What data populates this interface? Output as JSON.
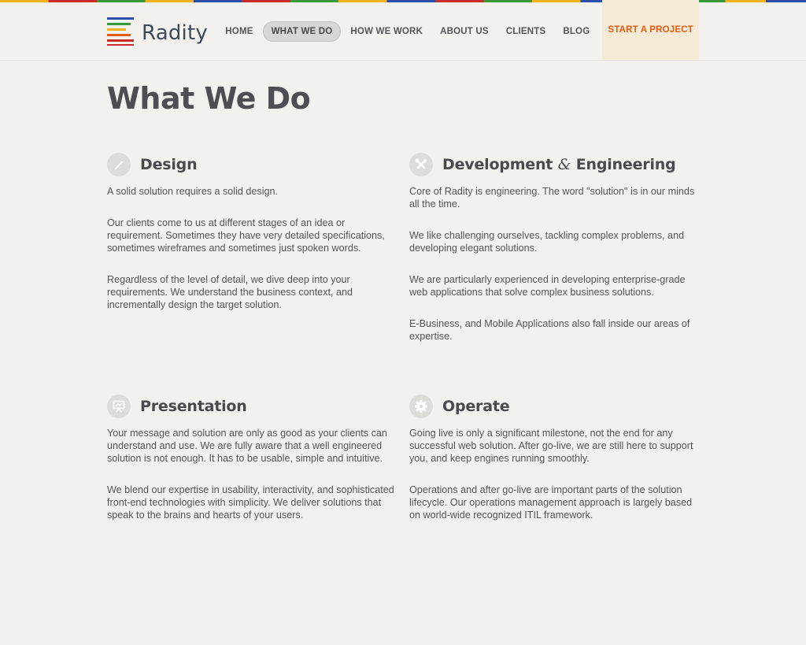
{
  "brand": {
    "name": "Radity"
  },
  "nav": {
    "items": [
      "HOME",
      "WHAT WE DO",
      "HOW WE WORK",
      "ABOUT US",
      "CLIENTS",
      "BLOG"
    ],
    "cta": "START A PROJECT",
    "active_index": 1
  },
  "page": {
    "title": "What We Do"
  },
  "sections": [
    {
      "title": "Design",
      "icon": "pencil-icon",
      "paragraphs": [
        "A solid solution requires a solid design.",
        "Our clients come to us at different stages of an idea or requirement. Sometimes they have very detailed specifications, sometimes wireframes and sometimes just spoken words.",
        "Regardless of the level of detail, we dive deep into your requirements. We understand the business context, and incrementally design the target solution."
      ]
    },
    {
      "title_part1": "Development",
      "title_amp": "&",
      "title_part2": "Engineering",
      "icon": "tools-icon",
      "paragraphs": [
        "Core of Radity is engineering. The word \"solution\" is in our minds all the time.",
        "We like challenging ourselves, tackling complex problems, and developing elegant solutions.",
        "We are particularly experienced in developing enterprise-grade web applications that solve complex business solutions.",
        "E-Business, and Mobile Applications also fall inside our areas of expertise."
      ]
    },
    {
      "title": "Presentation",
      "icon": "presentation-board-icon",
      "paragraphs": [
        "Your message and solution are only as good as your clients can understand and use. We are fully aware that a well engineered solution is not enough. It has to be usable, simple and intuitive.",
        "We blend our expertise in usability, interactivity, and sophisticated front-end technologies with simplicity. We deliver solutions that speak to the brains and hearts of your users."
      ]
    },
    {
      "title": "Operate",
      "icon": "gear-icon",
      "paragraphs": [
        "Going live is only a significant milestone, not the end for any successful web solution. After go-live, we are still here to support you, and keep engines running smoothly.",
        "Operations and after go-live are important parts of the solution lifecycle. Our operations management approach is largely based on world-wide recognized ITIL framework."
      ]
    }
  ],
  "colors": {
    "background": "#f2f1ee",
    "cta_text": "#e35b14",
    "cta_bg": "#f5ead6",
    "logo_stripes": [
      "#2b4fa8",
      "#3a9a3a",
      "#f3b21b",
      "#e35b14",
      "#cc2b2b"
    ]
  }
}
